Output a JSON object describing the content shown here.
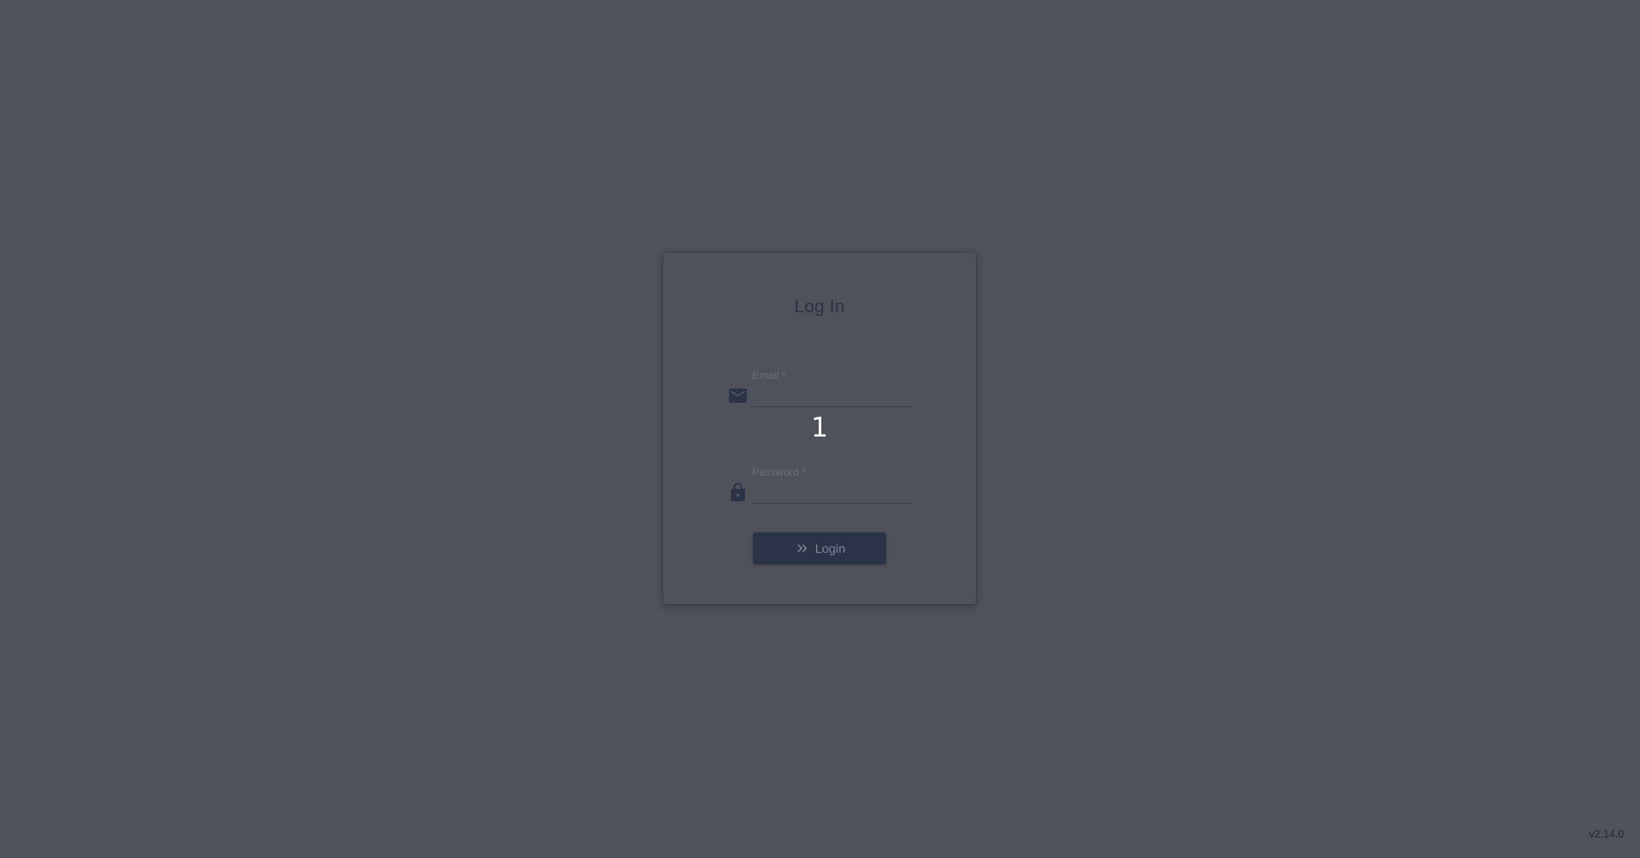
{
  "login": {
    "title": "Log In",
    "email_label": "Email *",
    "email_value": "",
    "password_label": "Password *",
    "password_value": "",
    "overlay_number": "1",
    "login_button": "Login",
    "icons": {
      "email": "envelope-icon",
      "password": "lock-icon",
      "login": "double-chevron-right-icon"
    }
  },
  "footer": {
    "version": "v2.14.0"
  },
  "colors": {
    "background": "#50535b",
    "card": "#4f525a",
    "title": "#2b3244",
    "button": "#2a3348",
    "icon": "#2b3349"
  }
}
